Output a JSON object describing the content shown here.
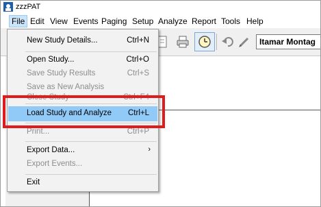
{
  "app": {
    "title": "zzzPAT"
  },
  "menubar": [
    {
      "label": "File"
    },
    {
      "label": "Edit"
    },
    {
      "label": "View"
    },
    {
      "label": "Events"
    },
    {
      "label": "Paging"
    },
    {
      "label": "Setup"
    },
    {
      "label": "Analyze"
    },
    {
      "label": "Report"
    },
    {
      "label": "Tools"
    },
    {
      "label": "Help"
    }
  ],
  "toolbar": {
    "patient_field": "Itamar Montag"
  },
  "file_menu": {
    "items": [
      {
        "label": "New Study Details...",
        "shortcut": "Ctrl+N",
        "enabled": true
      },
      {
        "label": "Open Study...",
        "shortcut": "Ctrl+O",
        "enabled": true
      },
      {
        "label": "Save Study Results",
        "shortcut": "Ctrl+S",
        "enabled": false
      },
      {
        "label": "Save as New Analysis",
        "shortcut": "",
        "enabled": false
      },
      {
        "label": "Close Study",
        "shortcut": "Ctrl+F4",
        "enabled": false
      },
      {
        "label": "Load Study and Analyze",
        "shortcut": "Ctrl+L",
        "enabled": true,
        "hovered": true
      },
      {
        "label": "Print...",
        "shortcut": "Ctrl+P",
        "enabled": false
      },
      {
        "label": "Export Data...",
        "shortcut": "",
        "enabled": true,
        "submenu": true
      },
      {
        "label": "Export Events...",
        "shortcut": "",
        "enabled": false
      },
      {
        "label": "Exit",
        "shortcut": "",
        "enabled": true
      }
    ]
  },
  "icons": {
    "app": "zzzpat-app-icon",
    "submenu": "chevron-right-icon"
  },
  "colors": {
    "highlight_box": "#e01b1b",
    "hover": "#91c9f7"
  }
}
